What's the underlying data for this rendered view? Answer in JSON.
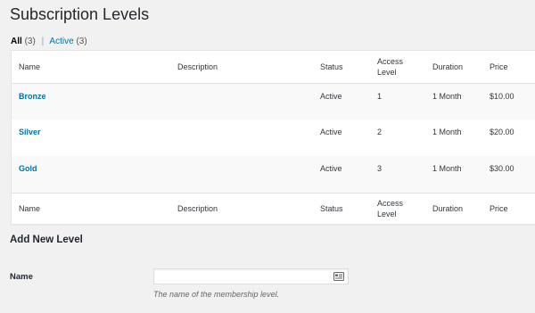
{
  "page": {
    "title": "Subscription Levels"
  },
  "filters": {
    "all_label": "All",
    "all_count": "(3)",
    "separator": "|",
    "active_label": "Active",
    "active_count": "(3)"
  },
  "table": {
    "columns": {
      "name": "Name",
      "description": "Description",
      "status": "Status",
      "access_line1": "Access",
      "access_line2": "Level",
      "duration": "Duration",
      "price": "Price"
    },
    "rows": [
      {
        "name": "Bronze",
        "description": "",
        "status": "Active",
        "access": "1",
        "duration": "1 Month",
        "price": "$10.00"
      },
      {
        "name": "Silver",
        "description": "",
        "status": "Active",
        "access": "2",
        "duration": "1 Month",
        "price": "$20.00"
      },
      {
        "name": "Gold",
        "description": "",
        "status": "Active",
        "access": "3",
        "duration": "1 Month",
        "price": "$30.00"
      }
    ]
  },
  "add_new": {
    "title": "Add New Level",
    "name_label": "Name",
    "name_value": "",
    "name_description": "The name of the membership level.",
    "input_icon": "contact-card-icon"
  },
  "colors": {
    "link": "#0073aa",
    "background": "#f1f1f1",
    "row_alt": "#f9f9f9"
  }
}
